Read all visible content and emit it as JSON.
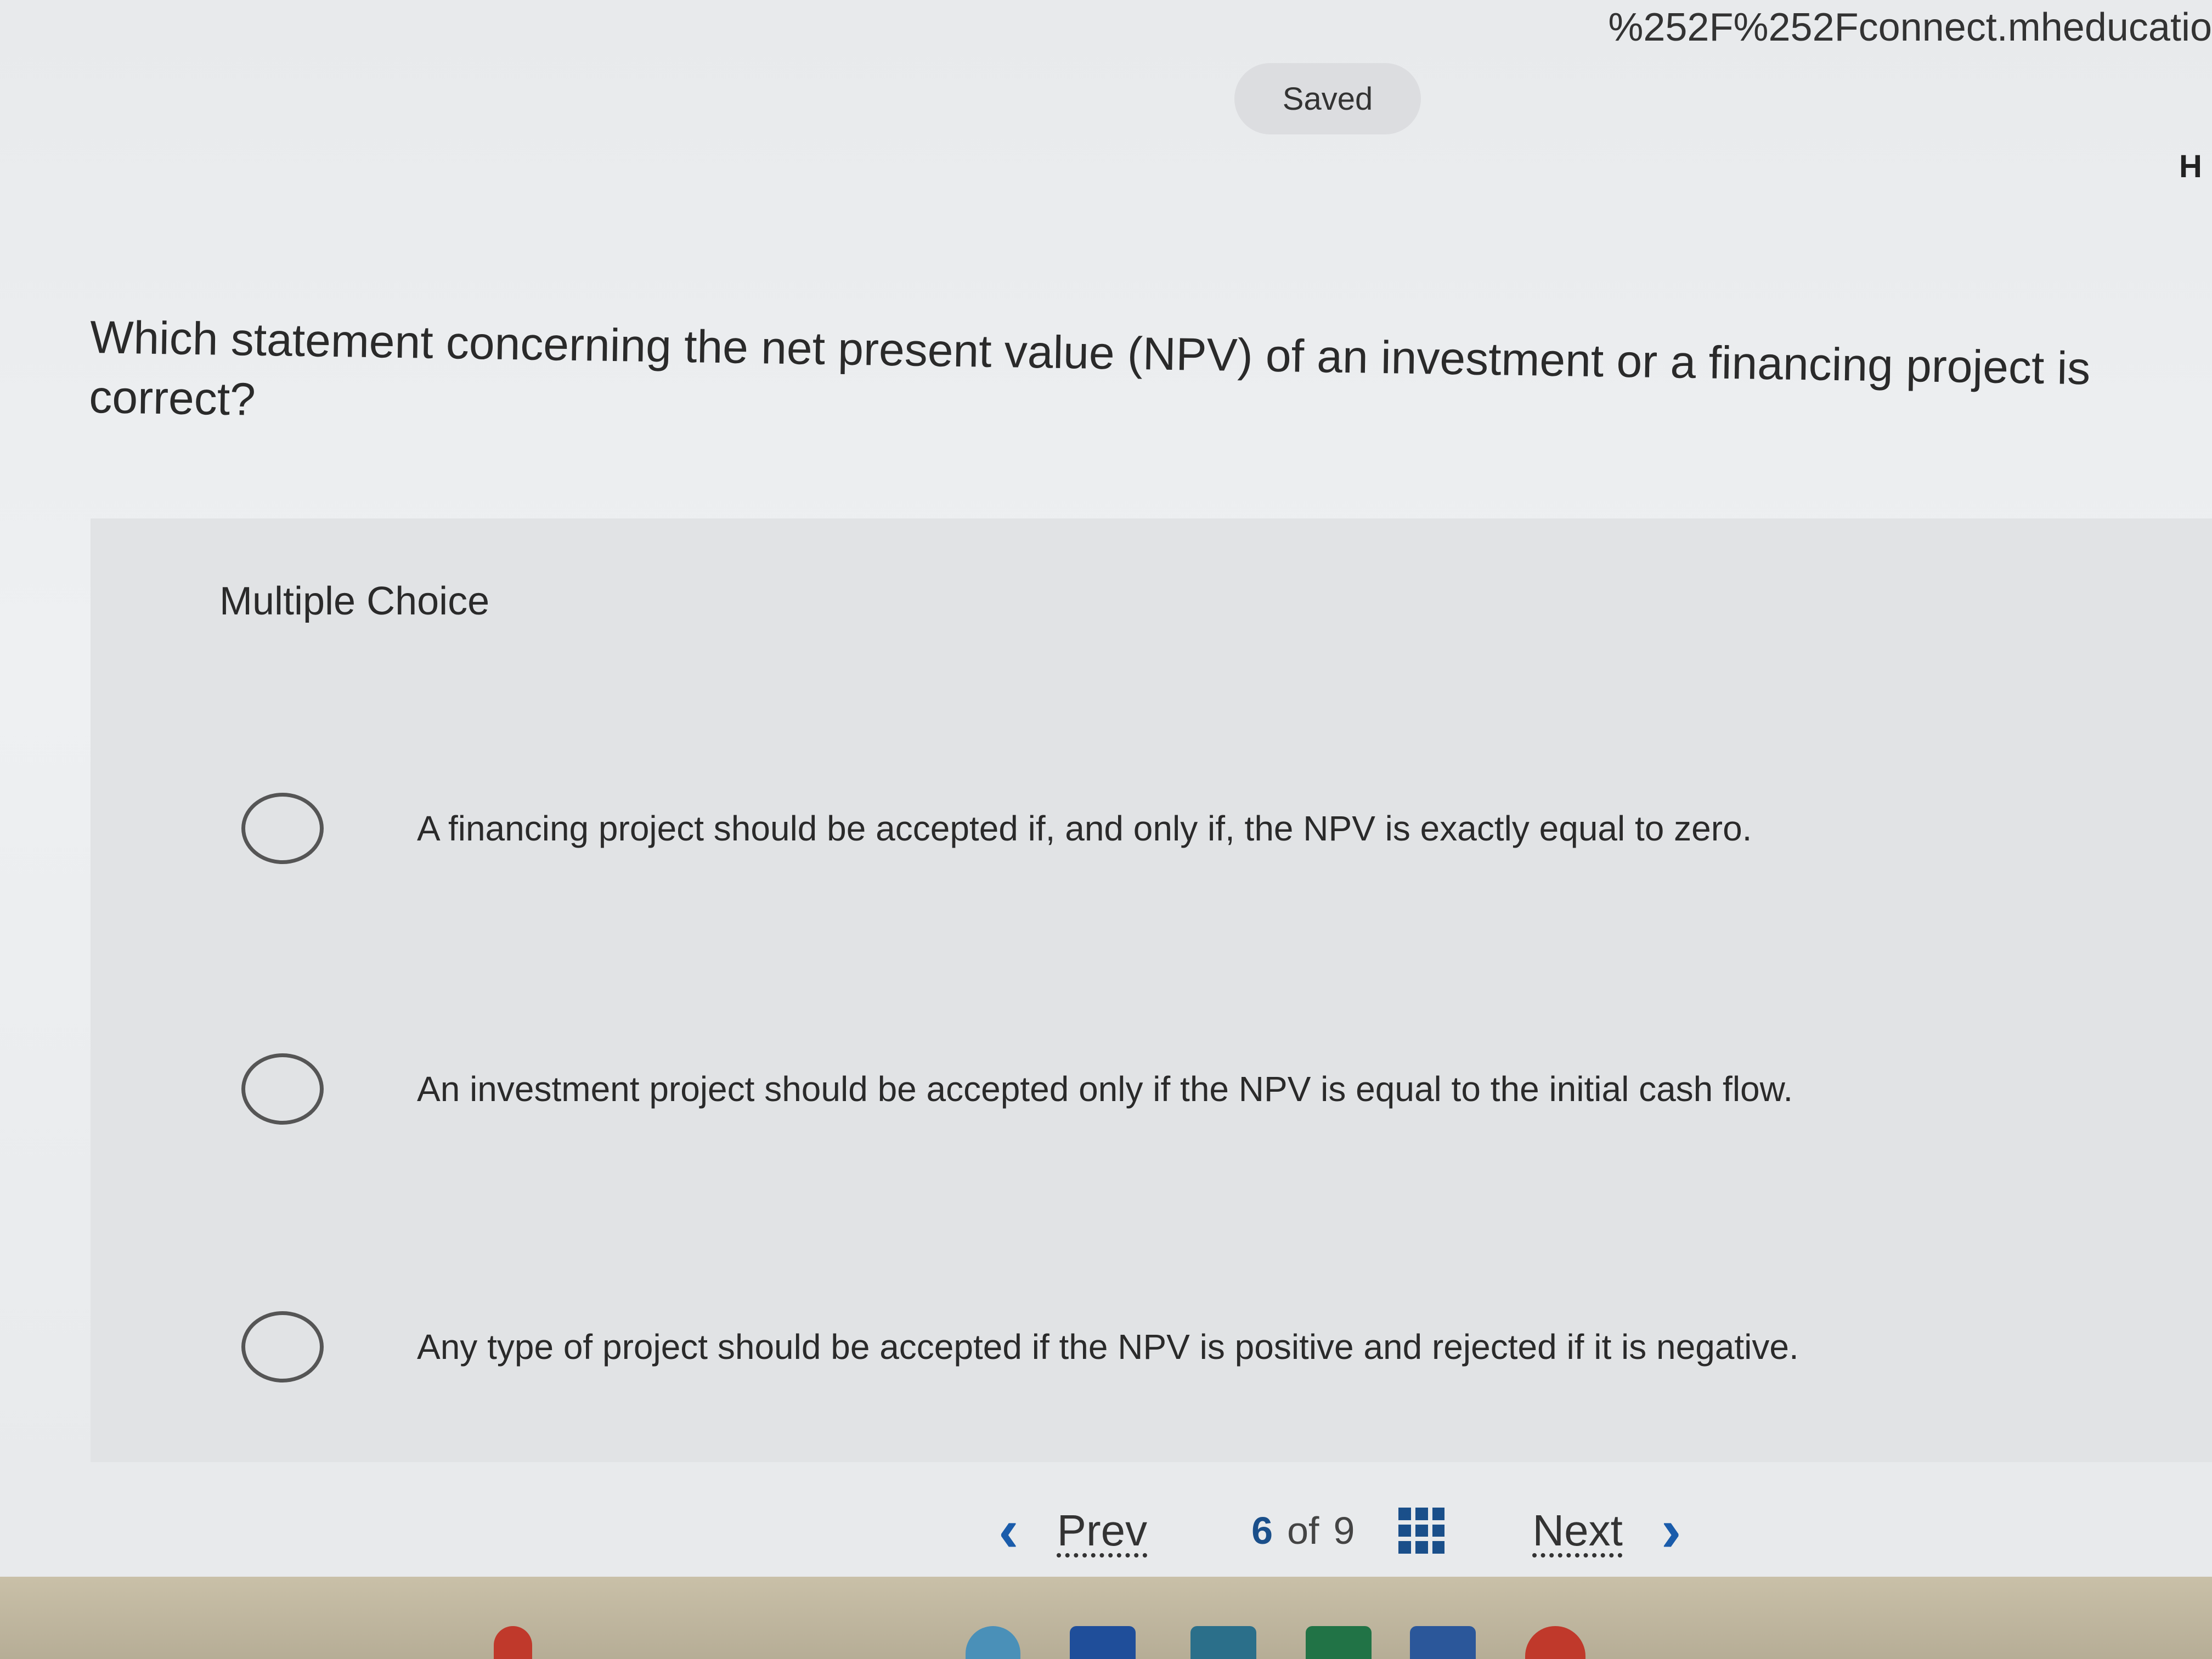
{
  "browser": {
    "url_fragment": "%252F%252Fconnect.mheducatio"
  },
  "status": {
    "saved_label": "Saved"
  },
  "header": {
    "help_fragment": "H"
  },
  "question": {
    "text": "Which statement concerning the net present value (NPV) of an investment or a financing project is correct?"
  },
  "multiple_choice": {
    "label": "Multiple Choice",
    "options": [
      {
        "label": "A financing project should be accepted if, and only if, the NPV is exactly equal to zero."
      },
      {
        "label": "An investment project should be accepted only if the NPV is equal to the initial cash flow."
      },
      {
        "label": "Any type of project should be accepted if the NPV is positive and rejected if it is negative."
      }
    ]
  },
  "navigation": {
    "prev_label": "Prev",
    "next_label": "Next",
    "current_page": "6",
    "of_label": "of",
    "total_pages": "9",
    "prev_icon": "chevron-left-icon",
    "next_icon": "chevron-right-icon",
    "grid_icon": "grid-icon",
    "accent_color": "#1a5cab"
  }
}
